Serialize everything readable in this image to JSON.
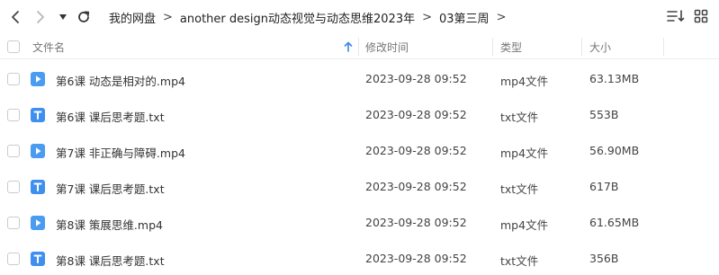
{
  "breadcrumb": {
    "items": [
      "我的网盘",
      "another design动态视觉与动态思维2023年",
      "03第三周"
    ],
    "separator": ">"
  },
  "columns": {
    "name": "文件名",
    "modified": "修改时间",
    "type": "类型",
    "size": "大小"
  },
  "colors": {
    "video_icon": "#4a9cf1",
    "text_icon": "#3f8ff0",
    "accent": "#3b87e8"
  },
  "files": [
    {
      "name": "第6课 动态是相对的.mp4",
      "date": "2023-09-28 09:52",
      "type": "mp4文件",
      "size": "63.13MB",
      "icon": "video-file-icon"
    },
    {
      "name": "第6课 课后思考题.txt",
      "date": "2023-09-28 09:52",
      "type": "txt文件",
      "size": "553B",
      "icon": "text-file-icon"
    },
    {
      "name": "第7课 非正确与障碍.mp4",
      "date": "2023-09-28 09:52",
      "type": "mp4文件",
      "size": "56.90MB",
      "icon": "video-file-icon"
    },
    {
      "name": "第7课 课后思考题.txt",
      "date": "2023-09-28 09:52",
      "type": "txt文件",
      "size": "617B",
      "icon": "text-file-icon"
    },
    {
      "name": "第8课 策展思维.mp4",
      "date": "2023-09-28 09:52",
      "type": "mp4文件",
      "size": "61.65MB",
      "icon": "video-file-icon"
    },
    {
      "name": "第8课 课后思考题.txt",
      "date": "2023-09-28 09:52",
      "type": "txt文件",
      "size": "356B",
      "icon": "text-file-icon"
    }
  ]
}
